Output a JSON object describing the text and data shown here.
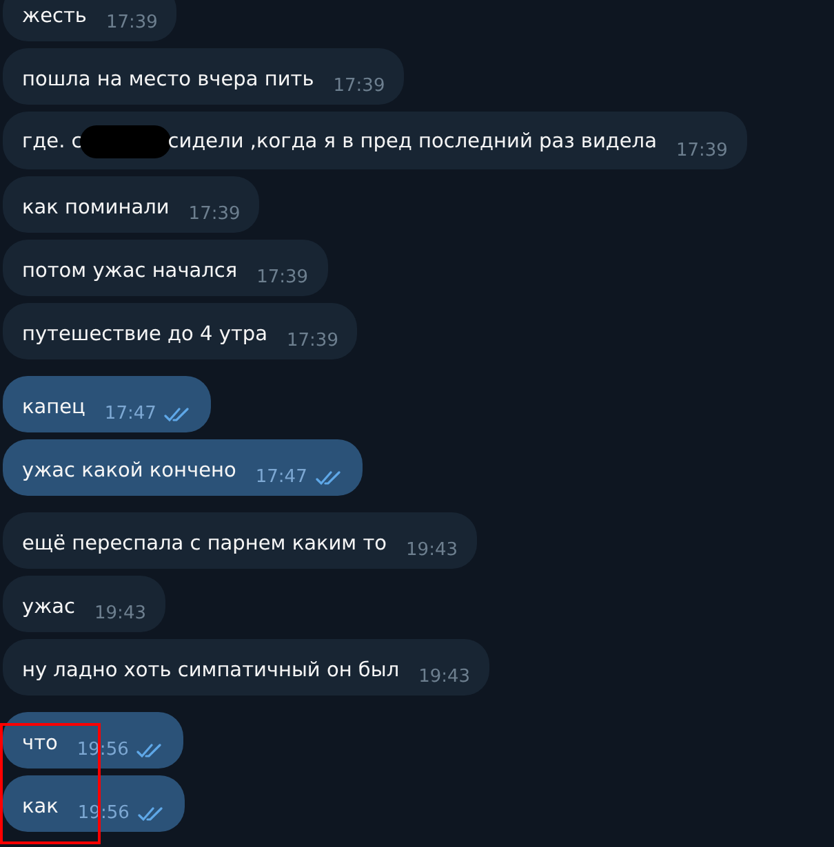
{
  "messages": [
    {
      "kind": "incoming",
      "text": "жесть",
      "time": "17:39"
    },
    {
      "kind": "incoming",
      "text": "пошла на место вчера пить",
      "time": "17:39"
    },
    {
      "kind": "incoming",
      "text": "где. с",
      "redacted": true,
      "text_after": "сидели ,когда я в пред последний раз видела",
      "time": "17:39"
    },
    {
      "kind": "incoming",
      "text": "как поминали",
      "time": "17:39"
    },
    {
      "kind": "incoming",
      "text": "потом ужас начался",
      "time": "17:39"
    },
    {
      "kind": "incoming",
      "text": "путешествие до 4 утра",
      "time": "17:39"
    },
    {
      "kind": "outgoing",
      "text": "капец",
      "time": "17:47",
      "read": true
    },
    {
      "kind": "outgoing",
      "text": "ужас какой кончено",
      "time": "17:47",
      "read": true
    },
    {
      "kind": "incoming",
      "text": "ещё переспала с парнем каким то",
      "time": "19:43"
    },
    {
      "kind": "incoming",
      "text": "ужас",
      "time": "19:43"
    },
    {
      "kind": "incoming",
      "text": "ну ладно хоть симпатичный он был",
      "time": "19:43"
    },
    {
      "kind": "outgoing",
      "text": "что",
      "time": "19:56",
      "read": true
    },
    {
      "kind": "outgoing",
      "text": "как",
      "time": "19:56",
      "read": true
    }
  ],
  "highlight": {
    "shown": true
  }
}
